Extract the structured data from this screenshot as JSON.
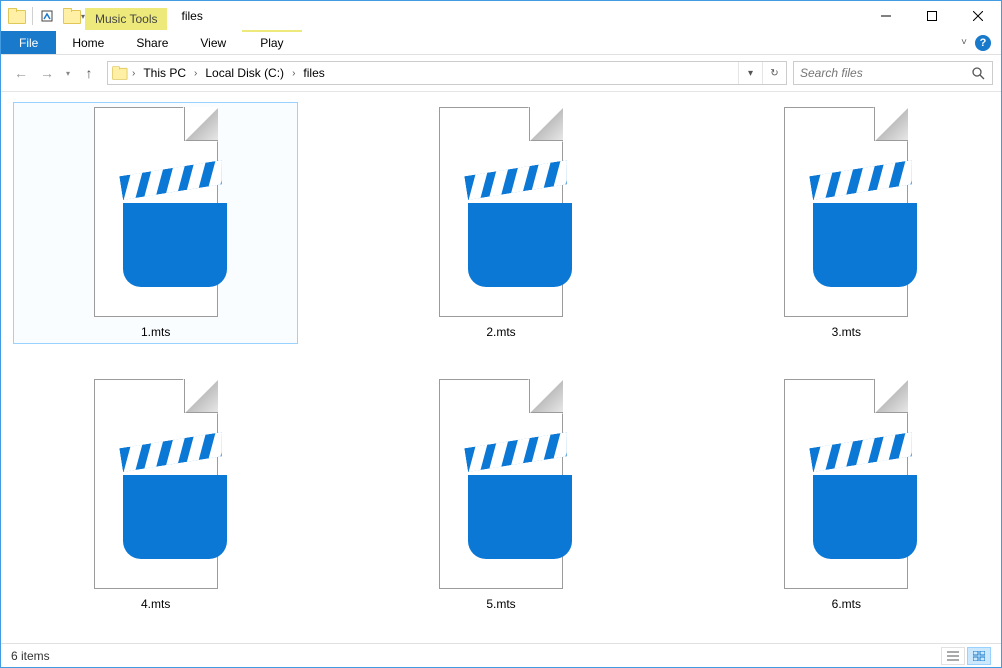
{
  "window": {
    "title": "files",
    "context_tab": "Music Tools"
  },
  "tabs": {
    "file": "File",
    "home": "Home",
    "share": "Share",
    "view": "View",
    "context": "Play"
  },
  "nav": {
    "crumbs": [
      "This PC",
      "Local Disk (C:)",
      "files"
    ]
  },
  "search": {
    "placeholder": "Search files"
  },
  "files": [
    {
      "name": "1.mts",
      "selected": true
    },
    {
      "name": "2.mts",
      "selected": false
    },
    {
      "name": "3.mts",
      "selected": false
    },
    {
      "name": "4.mts",
      "selected": false
    },
    {
      "name": "5.mts",
      "selected": false
    },
    {
      "name": "6.mts",
      "selected": false
    }
  ],
  "status": {
    "text": "6 items"
  }
}
